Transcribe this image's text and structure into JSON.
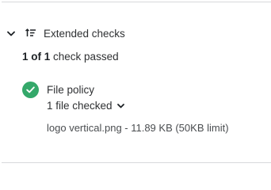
{
  "section": {
    "title": "Extended checks",
    "expanded": true
  },
  "summary": {
    "passed_count": "1 of 1",
    "suffix": "check passed"
  },
  "checks": [
    {
      "name": "File policy",
      "status": "passed",
      "status_color": "#34a86a",
      "icon": "check-circle-icon",
      "files_toggle_label": "1 file checked",
      "files": [
        "logo vertical.png - 11.89 KB (50KB limit)"
      ]
    }
  ],
  "icons": {
    "collapse": "chevron-down-icon",
    "section": "sort-lines-icon",
    "files_toggle": "chevron-down-icon"
  }
}
